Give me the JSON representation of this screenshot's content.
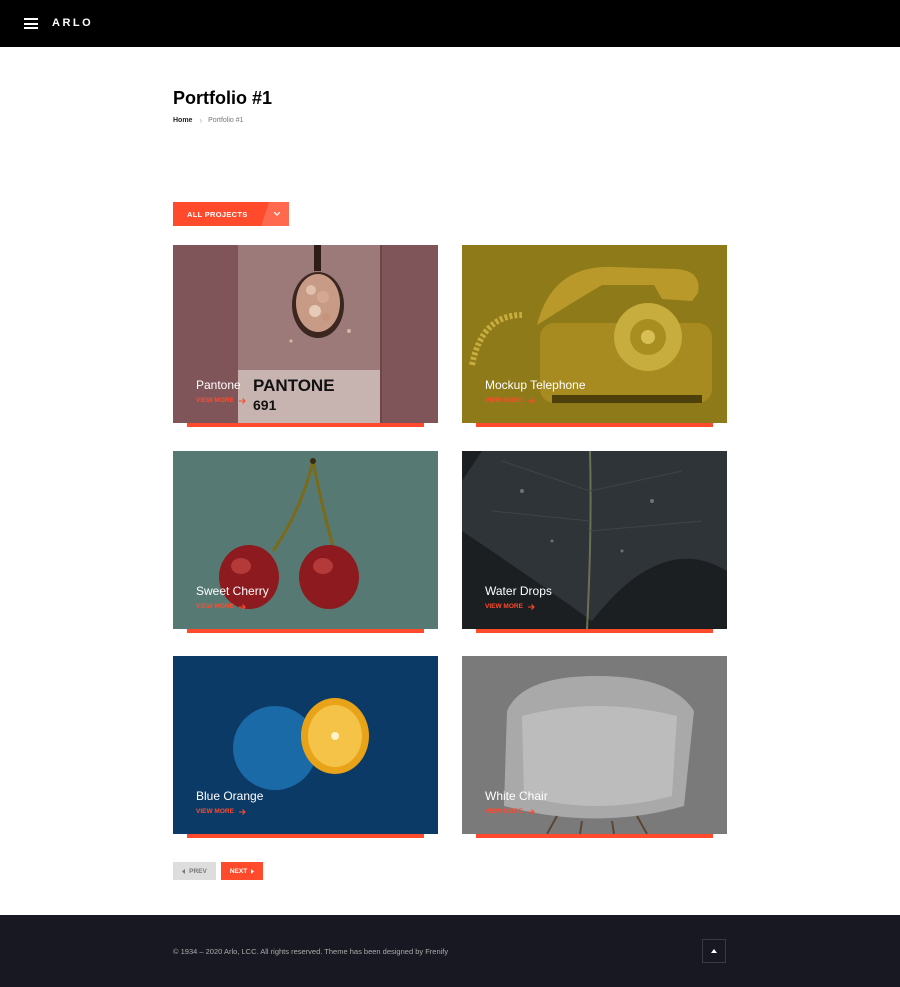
{
  "header": {
    "brand": "ARLO",
    "menu_icon": "hamburger-icon"
  },
  "page": {
    "title": "Portfolio #1",
    "breadcrumb": {
      "home": "Home",
      "current": "Portfolio #1"
    }
  },
  "filter": {
    "label": "ALL PROJECTS",
    "icon": "chevron-down-icon"
  },
  "projects": [
    {
      "title": "Pantone",
      "cta": "VIEW MORE",
      "image_text": "PANTONE",
      "image_number": "691"
    },
    {
      "title": "Mockup Telephone",
      "cta": "VIEW MORE"
    },
    {
      "title": "Sweet Cherry",
      "cta": "VIEW MORE"
    },
    {
      "title": "Water Drops",
      "cta": "VIEW MORE"
    },
    {
      "title": "Blue Orange",
      "cta": "VIEW MORE"
    },
    {
      "title": "White Chair",
      "cta": "VIEW MORE"
    }
  ],
  "pagination": {
    "prev": "PREV",
    "next": "NEXT"
  },
  "footer": {
    "copyright": "© 1934 – 2020 Arlo, LCC. All rights reserved. Theme has been designed by Frenify",
    "to_top_icon": "arrow-up-icon"
  },
  "colors": {
    "accent": "#ff4a2c",
    "header_bg": "#000000",
    "footer_bg": "#181822"
  }
}
